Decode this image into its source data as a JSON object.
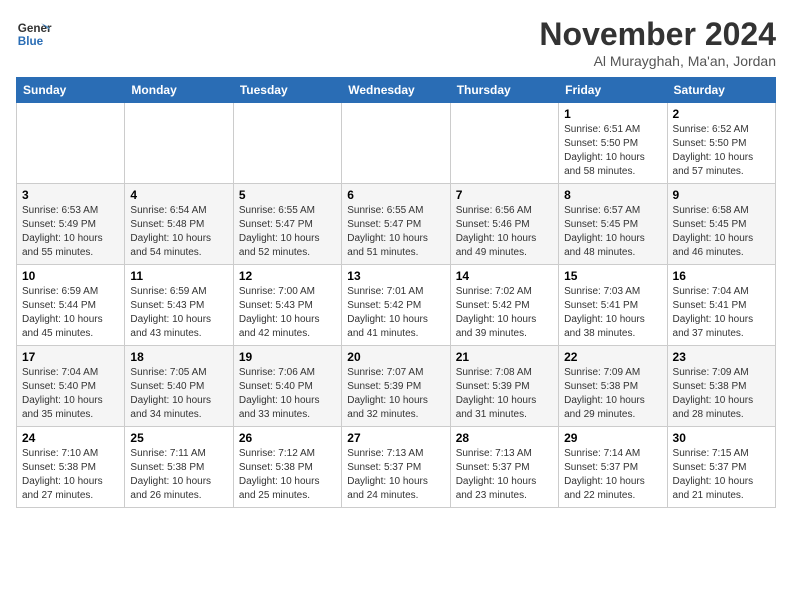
{
  "logo": {
    "line1": "General",
    "line2": "Blue"
  },
  "title": "November 2024",
  "location": "Al Murayghah, Ma'an, Jordan",
  "weekdays": [
    "Sunday",
    "Monday",
    "Tuesday",
    "Wednesday",
    "Thursday",
    "Friday",
    "Saturday"
  ],
  "weeks": [
    [
      {
        "day": "",
        "info": ""
      },
      {
        "day": "",
        "info": ""
      },
      {
        "day": "",
        "info": ""
      },
      {
        "day": "",
        "info": ""
      },
      {
        "day": "",
        "info": ""
      },
      {
        "day": "1",
        "info": "Sunrise: 6:51 AM\nSunset: 5:50 PM\nDaylight: 10 hours\nand 58 minutes."
      },
      {
        "day": "2",
        "info": "Sunrise: 6:52 AM\nSunset: 5:50 PM\nDaylight: 10 hours\nand 57 minutes."
      }
    ],
    [
      {
        "day": "3",
        "info": "Sunrise: 6:53 AM\nSunset: 5:49 PM\nDaylight: 10 hours\nand 55 minutes."
      },
      {
        "day": "4",
        "info": "Sunrise: 6:54 AM\nSunset: 5:48 PM\nDaylight: 10 hours\nand 54 minutes."
      },
      {
        "day": "5",
        "info": "Sunrise: 6:55 AM\nSunset: 5:47 PM\nDaylight: 10 hours\nand 52 minutes."
      },
      {
        "day": "6",
        "info": "Sunrise: 6:55 AM\nSunset: 5:47 PM\nDaylight: 10 hours\nand 51 minutes."
      },
      {
        "day": "7",
        "info": "Sunrise: 6:56 AM\nSunset: 5:46 PM\nDaylight: 10 hours\nand 49 minutes."
      },
      {
        "day": "8",
        "info": "Sunrise: 6:57 AM\nSunset: 5:45 PM\nDaylight: 10 hours\nand 48 minutes."
      },
      {
        "day": "9",
        "info": "Sunrise: 6:58 AM\nSunset: 5:45 PM\nDaylight: 10 hours\nand 46 minutes."
      }
    ],
    [
      {
        "day": "10",
        "info": "Sunrise: 6:59 AM\nSunset: 5:44 PM\nDaylight: 10 hours\nand 45 minutes."
      },
      {
        "day": "11",
        "info": "Sunrise: 6:59 AM\nSunset: 5:43 PM\nDaylight: 10 hours\nand 43 minutes."
      },
      {
        "day": "12",
        "info": "Sunrise: 7:00 AM\nSunset: 5:43 PM\nDaylight: 10 hours\nand 42 minutes."
      },
      {
        "day": "13",
        "info": "Sunrise: 7:01 AM\nSunset: 5:42 PM\nDaylight: 10 hours\nand 41 minutes."
      },
      {
        "day": "14",
        "info": "Sunrise: 7:02 AM\nSunset: 5:42 PM\nDaylight: 10 hours\nand 39 minutes."
      },
      {
        "day": "15",
        "info": "Sunrise: 7:03 AM\nSunset: 5:41 PM\nDaylight: 10 hours\nand 38 minutes."
      },
      {
        "day": "16",
        "info": "Sunrise: 7:04 AM\nSunset: 5:41 PM\nDaylight: 10 hours\nand 37 minutes."
      }
    ],
    [
      {
        "day": "17",
        "info": "Sunrise: 7:04 AM\nSunset: 5:40 PM\nDaylight: 10 hours\nand 35 minutes."
      },
      {
        "day": "18",
        "info": "Sunrise: 7:05 AM\nSunset: 5:40 PM\nDaylight: 10 hours\nand 34 minutes."
      },
      {
        "day": "19",
        "info": "Sunrise: 7:06 AM\nSunset: 5:40 PM\nDaylight: 10 hours\nand 33 minutes."
      },
      {
        "day": "20",
        "info": "Sunrise: 7:07 AM\nSunset: 5:39 PM\nDaylight: 10 hours\nand 32 minutes."
      },
      {
        "day": "21",
        "info": "Sunrise: 7:08 AM\nSunset: 5:39 PM\nDaylight: 10 hours\nand 31 minutes."
      },
      {
        "day": "22",
        "info": "Sunrise: 7:09 AM\nSunset: 5:38 PM\nDaylight: 10 hours\nand 29 minutes."
      },
      {
        "day": "23",
        "info": "Sunrise: 7:09 AM\nSunset: 5:38 PM\nDaylight: 10 hours\nand 28 minutes."
      }
    ],
    [
      {
        "day": "24",
        "info": "Sunrise: 7:10 AM\nSunset: 5:38 PM\nDaylight: 10 hours\nand 27 minutes."
      },
      {
        "day": "25",
        "info": "Sunrise: 7:11 AM\nSunset: 5:38 PM\nDaylight: 10 hours\nand 26 minutes."
      },
      {
        "day": "26",
        "info": "Sunrise: 7:12 AM\nSunset: 5:38 PM\nDaylight: 10 hours\nand 25 minutes."
      },
      {
        "day": "27",
        "info": "Sunrise: 7:13 AM\nSunset: 5:37 PM\nDaylight: 10 hours\nand 24 minutes."
      },
      {
        "day": "28",
        "info": "Sunrise: 7:13 AM\nSunset: 5:37 PM\nDaylight: 10 hours\nand 23 minutes."
      },
      {
        "day": "29",
        "info": "Sunrise: 7:14 AM\nSunset: 5:37 PM\nDaylight: 10 hours\nand 22 minutes."
      },
      {
        "day": "30",
        "info": "Sunrise: 7:15 AM\nSunset: 5:37 PM\nDaylight: 10 hours\nand 21 minutes."
      }
    ]
  ]
}
